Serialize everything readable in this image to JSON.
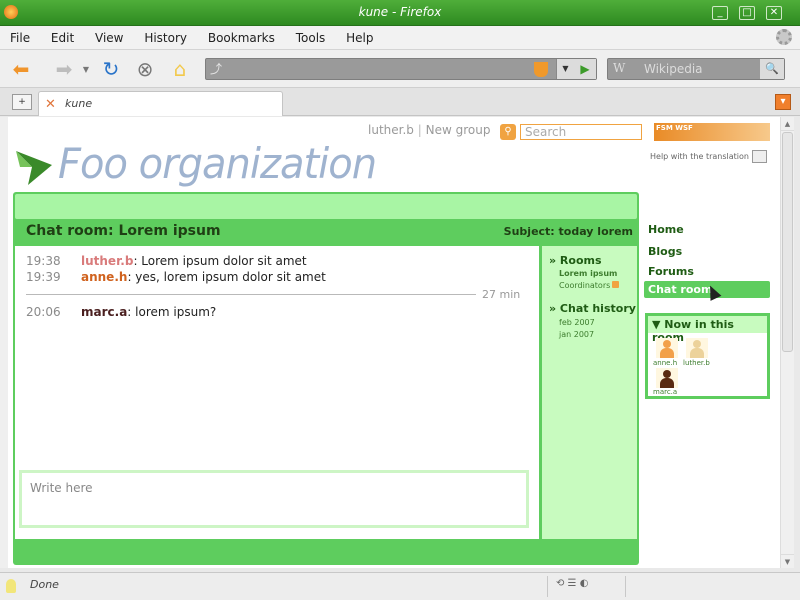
{
  "window": {
    "title": "kune - Firefox"
  },
  "menu": [
    "File",
    "Edit",
    "View",
    "History",
    "Bookmarks",
    "Tools",
    "Help"
  ],
  "search_engine": "Wikipedia",
  "tab": {
    "label": "kune"
  },
  "header": {
    "user": "luther.b",
    "separator": "|",
    "new_group": "New group",
    "search_placeholder": "Search",
    "fsm_badge": "FSM WSF",
    "help_translation": "Help with the translation",
    "org_name": "Foo organization"
  },
  "chat": {
    "title": "Chat room: Lorem ipsum",
    "subject": "Subject: today lorem",
    "messages": [
      {
        "time": "19:38",
        "user": "luther.b",
        "user_color": "#d97b7b",
        "text": ": Lorem ipsum dolor sit amet"
      },
      {
        "time": "19:39",
        "user": "anne.h",
        "user_color": "#d0621e",
        "text": ": yes, lorem ipsum dolor sit amet"
      },
      {
        "time": "20:06",
        "user": "marc.a",
        "user_color": "#4a1f1f",
        "text": ": lorem ipsum?"
      }
    ],
    "gap_label": "27 min",
    "input_placeholder": "Write here",
    "side": {
      "rooms_heading": "» Rooms",
      "room_name": "Lorem ipsum",
      "coordinators": "Coordinators",
      "history_heading": "» Chat history",
      "history": [
        "feb 2007",
        "jan 2007"
      ]
    }
  },
  "right_nav": {
    "items": [
      "Home",
      "Blogs",
      "Forums"
    ],
    "active": "Chat room"
  },
  "now_in_room": {
    "heading": "▼ Now in this room",
    "users": [
      {
        "name": "anne.h",
        "color": "#f2a04a"
      },
      {
        "name": "luther.b",
        "color": "#ecd29a"
      },
      {
        "name": "marc.a",
        "color": "#5a2a12"
      }
    ]
  },
  "statusbar": {
    "status": "Done"
  },
  "colors": {
    "accent": "#5ecd5e",
    "accent_light": "#c8fbbf",
    "chrome_green": "#38a02a"
  }
}
